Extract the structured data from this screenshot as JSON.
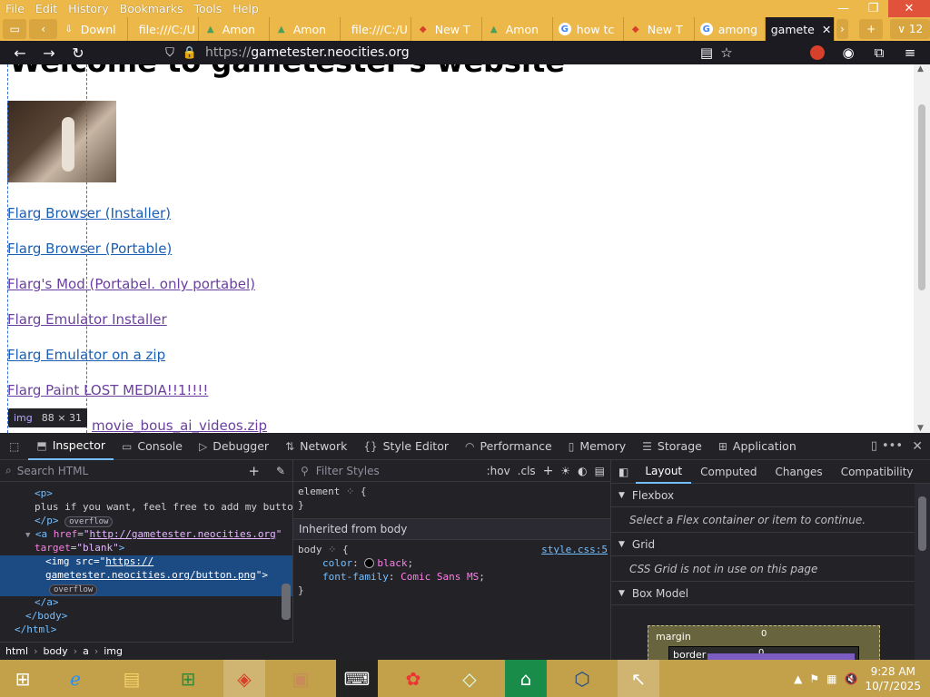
{
  "browser": {
    "menu": [
      "File",
      "Edit",
      "History",
      "Bookmarks",
      "Tools",
      "Help"
    ],
    "window_controls": {
      "minimize": "—",
      "restore": "❐",
      "close": "✕"
    },
    "tabs": [
      {
        "label": "Downl",
        "icon": "download-icon",
        "kind": "file"
      },
      {
        "label": "file:///C:/U",
        "icon": "file-icon",
        "kind": "file"
      },
      {
        "label": "Amon",
        "icon": "amon-icon",
        "kind": "amon"
      },
      {
        "label": "Amon",
        "icon": "amon-icon",
        "kind": "amon"
      },
      {
        "label": "file:///C:/U",
        "icon": "file-icon",
        "kind": "file"
      },
      {
        "label": "New T",
        "icon": "newtab-icon",
        "kind": "newt"
      },
      {
        "label": "Amon",
        "icon": "amon-icon",
        "kind": "amon"
      },
      {
        "label": "how tc",
        "icon": "google-icon",
        "kind": "goog"
      },
      {
        "label": "New T",
        "icon": "newtab-icon",
        "kind": "newt"
      },
      {
        "label": "among",
        "icon": "google-icon",
        "kind": "goog"
      },
      {
        "label": "gamete",
        "icon": "",
        "kind": "active"
      }
    ],
    "tab_count": "12",
    "url_prefix": "https://",
    "url_host": "gametester.neocities.org"
  },
  "page": {
    "heading": "Welcome to gametester's website",
    "links": [
      {
        "text": "Flarg Browser (Installer)",
        "color": "blue"
      },
      {
        "text": "Flarg Browser (Portable)",
        "color": "blue"
      },
      {
        "text": "Flarg's Mod (Portabel. only portabel)",
        "color": "purple"
      },
      {
        "text": "Flarg Emulator Installer",
        "color": "purple"
      },
      {
        "text": "Flarg Emulator on a zip",
        "color": "blue"
      },
      {
        "text": "Flarg Paint LOST MEDIA!!1!!!!",
        "color": "purple"
      },
      {
        "text": "movie_bous_ai_videos.zip",
        "color": "purple"
      }
    ],
    "tooltip": {
      "tag": "img",
      "size": "88 × 31"
    }
  },
  "devtools": {
    "tabs": [
      "Inspector",
      "Console",
      "Debugger",
      "Network",
      "Style Editor",
      "Performance",
      "Memory",
      "Storage",
      "Application"
    ],
    "search_placeholder": "Search HTML",
    "filter_placeholder": "Filter Styles",
    "hov": ":hov",
    "cls": ".cls",
    "markup": {
      "p_open": "<p>",
      "p_text": "plus if you want, feel free to add my button",
      "p_close": "</p>",
      "overflow": "overflow",
      "a_href": "http://gametester.neocities.org",
      "a_target": "blank",
      "img_src_1": "https://",
      "img_src_2": "gametester.neocities.org/button.png",
      "a_close": "</a>",
      "body_close": "</body>",
      "html_close": "</html>"
    },
    "rules": {
      "element": "element",
      "inherited": "Inherited from body",
      "selector": "body",
      "source": "style.css:5",
      "color_prop": "color",
      "color_val": "black",
      "font_prop": "font-family",
      "font_val": "Comic Sans MS"
    },
    "layout_tabs": [
      "Layout",
      "Computed",
      "Changes",
      "Compatibility"
    ],
    "flexbox": "Flexbox",
    "flexbox_msg": "Select a Flex container or item to continue.",
    "grid": "Grid",
    "grid_msg": "CSS Grid is not in use on this page",
    "box_model": "Box Model",
    "margin_label": "margin",
    "margin_val": "0",
    "border_label": "border",
    "border_val": "0",
    "breadcrumb": [
      "html",
      "body",
      "a",
      "img"
    ]
  },
  "taskbar": {
    "clock_time": "9:28 AM",
    "clock_date": "10/7/2025"
  }
}
